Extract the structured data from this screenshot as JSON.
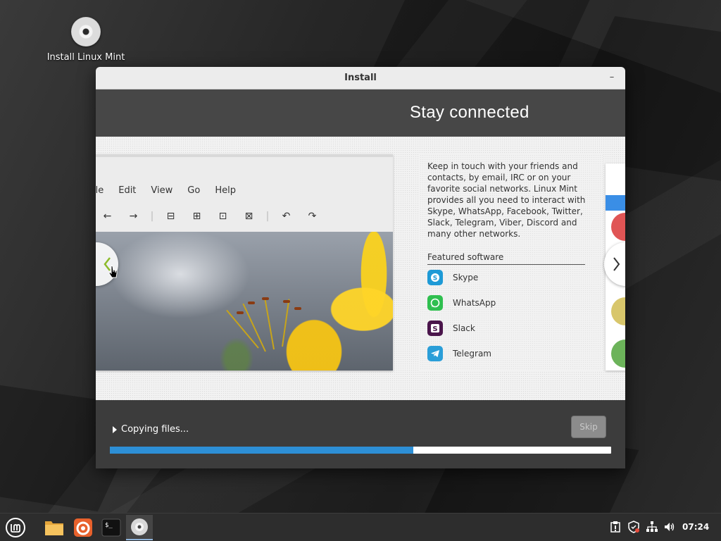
{
  "desktop": {
    "icon_label": "Install Linux Mint"
  },
  "window": {
    "title": "Install",
    "minimize_glyph": "–",
    "slide": {
      "heading": "Stay connected",
      "screenshot_menu": [
        "ile",
        "Edit",
        "View",
        "Go",
        "Help"
      ],
      "description": "Keep in touch with your friends and contacts, by email, IRC or on your favorite social networks. Linux Mint provides all you need to interact with Skype, WhatsApp, Facebook, Twitter, Slack, Telegram, Viber, Discord and many other networks.",
      "featured_title": "Featured software",
      "software": [
        {
          "name": "Skype",
          "icon": "skype-icon",
          "color": "#1e9ad6"
        },
        {
          "name": "WhatsApp",
          "icon": "whatsapp-icon",
          "color": "#2fbf4f"
        },
        {
          "name": "Slack",
          "icon": "slack-icon",
          "color": "#4a154b"
        },
        {
          "name": "Telegram",
          "icon": "telegram-icon",
          "color": "#2a9ed8"
        }
      ]
    },
    "status": "Copying files...",
    "skip_label": "Skip",
    "progress": 0.605
  },
  "taskbar": {
    "clock": "07:24",
    "apps": [
      "mint-menu-icon",
      "files-icon",
      "firefox-icon",
      "terminal-icon",
      "installer-icon"
    ]
  },
  "colors": {
    "accent": "#2d8fd6",
    "header_band": "#474747",
    "window_footer": "#3c3c3c"
  }
}
